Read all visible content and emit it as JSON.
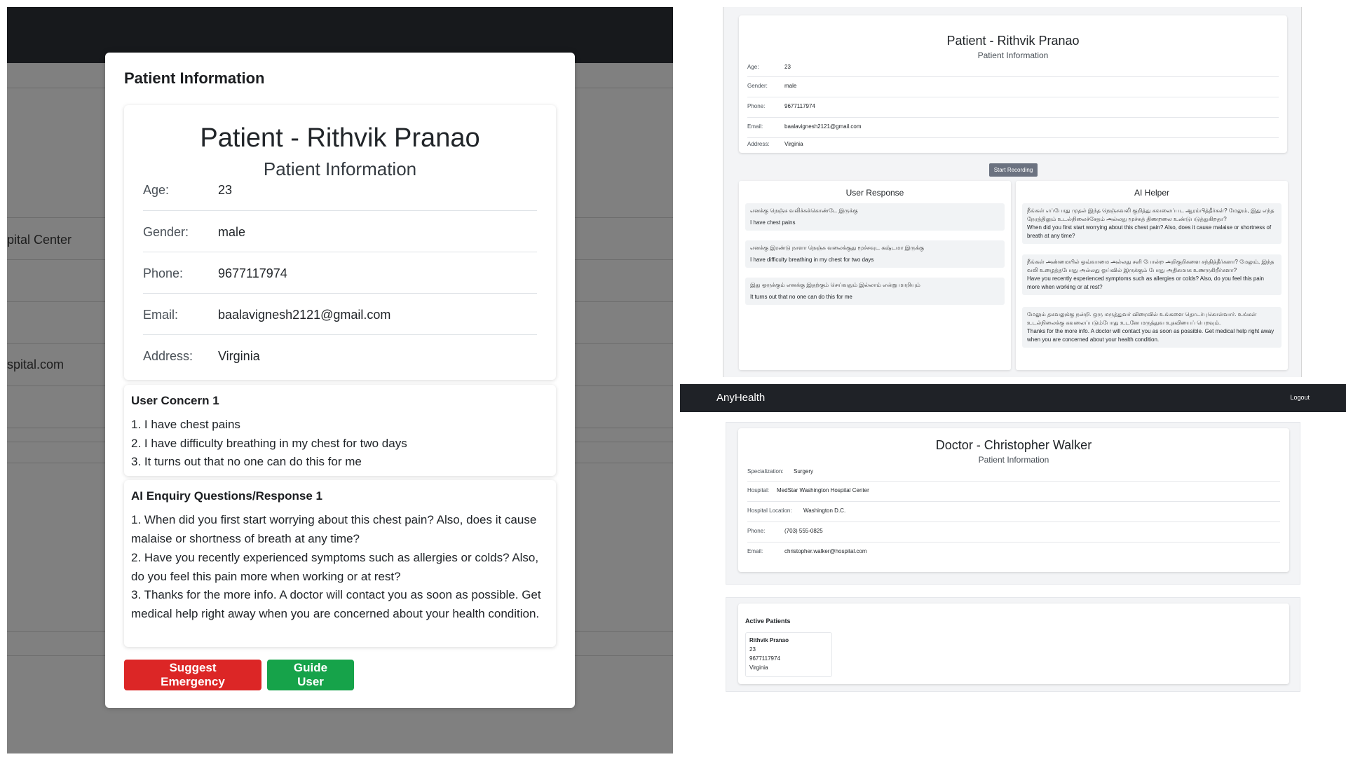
{
  "left": {
    "bg_texts": [
      "pital Center",
      "spital.com"
    ],
    "modal": {
      "title": "Patient Information",
      "patient_name": "Patient - Rithvik Pranao",
      "subtitle": "Patient Information",
      "fields": [
        {
          "label": "Age:",
          "value": "23"
        },
        {
          "label": "Gender:",
          "value": "male"
        },
        {
          "label": "Phone:",
          "value": "9677117974"
        },
        {
          "label": "Email:",
          "value": "baalavignesh2121@gmail.com"
        },
        {
          "label": "Address:",
          "value": "Virginia"
        }
      ],
      "concern": {
        "title": "User Concern 1",
        "items": [
          "1. I have chest pains",
          "2. I have difficulty breathing in my chest for two days",
          "3. It turns out that no one can do this for me"
        ]
      },
      "enquiry": {
        "title": "AI Enquiry Questions/Response 1",
        "items": [
          "1. When did you first start worrying about this chest pain? Also, does it cause malaise or shortness of breath at any time?",
          "2. Have you recently experienced symptoms such as allergies or colds? Also, do you feel this pain more when working or at rest?",
          "3. Thanks for the more info. A doctor will contact you as soon as possible. Get medical help right away when you are concerned about your health condition."
        ]
      },
      "buttons": {
        "emergency": "Suggest Emergency",
        "guide": "Guide User"
      },
      "colors": {
        "emergency": "#dc2626",
        "guide": "#16a34a"
      }
    }
  },
  "top_right": {
    "patient_name": "Patient - Rithvik Pranao",
    "subtitle": "Patient Information",
    "fields": [
      {
        "label": "Age:",
        "value": "23"
      },
      {
        "label": "Gender:",
        "value": "male"
      },
      {
        "label": "Phone:",
        "value": "9677117974"
      },
      {
        "label": "Email:",
        "value": "baalavignesh2121@gmail.com"
      },
      {
        "label": "Address:",
        "value": "Virginia"
      }
    ],
    "record_button": "Start Recording",
    "user_response": {
      "title": "User Response",
      "messages": [
        {
          "ta": "எனக்கு நெஞ்சு வலிச்சுக்கொண்டே இருக்கு",
          "en": "I have chest pains"
        },
        {
          "ta": "எனக்கு இரண்டு நாளா நெஞ்சு வலைக்குது மூச்சவுட கஷ்டமா இருக்கு",
          "en": "I have difficulty breathing in my chest for two days"
        },
        {
          "ta": "இது ஒருக்கும் எனக்கு இதற்கும் செய்வதும் இல்லாம் என்று மாறியும்",
          "en": "It turns out that no one can do this for me"
        }
      ]
    },
    "ai_helper": {
      "title": "AI Helper",
      "messages": [
        {
          "ta": "நீங்கள் எப்போது முதல் இந்த நெஞ்சுவலி குறித்து கவலைப்பட ஆரம்பித்தீர்கள்? மேலும், இது எந்த நேரத்திலும் உடல்நிலைச்சேதம் அல்லது மூச்சுத் திணறலை உண்டுபடுத்துகிறதா?",
          "en": "When did you first start worrying about this chest pain? Also, does it cause malaise or shortness of breath at any time?"
        },
        {
          "ta": "நீங்கள் அண்மையில் ஒவ்வாமை அல்லது சளி போன்ற அறிகுறிகளை சந்தித்தீர்களா? மேலும், இந்த வலி உழைத்தபோது அல்லது ஓய்வில் இருக்கும் போது அதிகமாக உணருகிறீர்களா?",
          "en": "Have you recently experienced symptoms such as allergies or colds? Also, do you feel this pain more when working or at rest?"
        },
        {
          "ta": "மேலும் தகவலுக்கு நன்றி. ஒரு மருத்துவர் விரைவில் உங்களை தொடர்புகொள்வார். உங்கள் உடல்நிலைக்கு கவலைப்படும்போது உடனே மருத்துவ உதவியைப் பெறவும்.",
          "en": "Thanks for the more info. A doctor will contact you as soon as possible. Get medical help right away when you are concerned about your health condition."
        }
      ]
    }
  },
  "bottom_right": {
    "brand": "AnyHealth",
    "logout": "Logout",
    "doctor_name": "Doctor - Christopher Walker",
    "subtitle": "Patient Information",
    "fields": [
      {
        "label": "Specialization:",
        "value": "Surgery"
      },
      {
        "label": "Hospital:",
        "value": "MedStar Washington Hospital Center"
      },
      {
        "label": "Hospital Location:",
        "value": "Washington D.C."
      },
      {
        "label": "Phone:",
        "value": "(703) 555-0825"
      },
      {
        "label": "Email:",
        "value": "christopher.walker@hospital.com"
      }
    ],
    "active_patients": {
      "title": "Active Patients",
      "patients": [
        {
          "name": "Rithvik Pranao",
          "age": "23",
          "phone": "9677117974",
          "address": "Virginia"
        }
      ]
    }
  }
}
